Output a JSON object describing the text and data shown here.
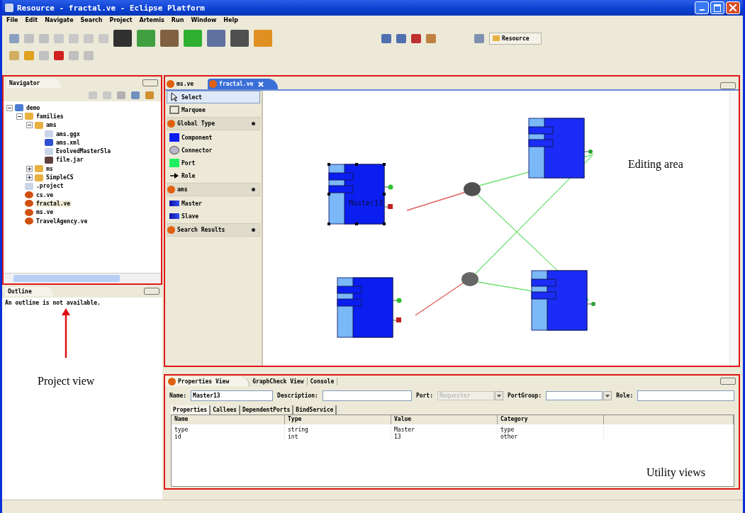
{
  "window": {
    "title": "Resource - fractal.ve - Eclipse Platform"
  },
  "menu": [
    "File",
    "Edit",
    "Navigate",
    "Search",
    "Project",
    "Artemis",
    "Run",
    "Window",
    "Help"
  ],
  "perspective": {
    "label": "Resource"
  },
  "navigator": {
    "title": "Navigator",
    "tree": [
      {
        "label": "demo",
        "kind": "project",
        "expanded": true,
        "selected": false,
        "children": [
          {
            "label": "families",
            "kind": "folder",
            "expanded": true,
            "selected": false,
            "children": [
              {
                "label": "ams",
                "kind": "folder",
                "expanded": true,
                "selected": false,
                "children": [
                  {
                    "label": "ams.ggx",
                    "kind": "file",
                    "selected": false
                  },
                  {
                    "label": "ams.xml",
                    "kind": "xml",
                    "selected": false
                  },
                  {
                    "label": "EvolvedMasterSla",
                    "kind": "file",
                    "selected": false
                  },
                  {
                    "label": "file.jar",
                    "kind": "jar",
                    "selected": false
                  }
                ]
              },
              {
                "label": "ms",
                "kind": "folder",
                "expanded": false,
                "selected": false
              },
              {
                "label": "SimpleCS",
                "kind": "folder",
                "expanded": false,
                "selected": false
              }
            ]
          },
          {
            "label": ".project",
            "kind": "file",
            "selected": false
          },
          {
            "label": "cs.ve",
            "kind": "ve",
            "selected": false
          },
          {
            "label": "fractal.ve",
            "kind": "ve",
            "selected": true
          },
          {
            "label": "ms.ve",
            "kind": "ve",
            "selected": false
          },
          {
            "label": "TravelAgency.ve",
            "kind": "ve",
            "selected": false
          }
        ]
      }
    ]
  },
  "outline": {
    "title": "Outline",
    "message": "An outline is not available."
  },
  "editor_tabs": [
    {
      "label": "ms.ve",
      "selected": false
    },
    {
      "label": "fractal.ve",
      "selected": true
    }
  ],
  "palette": [
    {
      "kind": "select",
      "label": "Select",
      "selected": true
    },
    {
      "kind": "marquee",
      "label": "Marquee",
      "selected": false
    },
    {
      "kind": "drawer",
      "label": "Global Type"
    },
    {
      "kind": "component",
      "label": "Component",
      "selected": false
    },
    {
      "kind": "connector",
      "label": "Connector",
      "selected": false
    },
    {
      "kind": "port",
      "label": "Port",
      "selected": false
    },
    {
      "kind": "role",
      "label": "Role",
      "selected": false
    },
    {
      "kind": "drawer",
      "label": "ams"
    },
    {
      "kind": "master",
      "label": "Master",
      "selected": false
    },
    {
      "kind": "slave",
      "label": "Slave",
      "selected": false
    },
    {
      "kind": "drawer",
      "label": "Search Results"
    }
  ],
  "diagram": {
    "components": [
      {
        "kind": "master",
        "label": "Master13",
        "selected": true
      },
      {
        "kind": "slave",
        "selected": false
      },
      {
        "kind": "master",
        "selected": false
      },
      {
        "kind": "slave",
        "selected": false
      }
    ]
  },
  "properties": {
    "views": [
      {
        "label": "Properties View",
        "selected": true
      },
      {
        "label": "GraphCheck View",
        "selected": false
      },
      {
        "label": "Console",
        "selected": false
      }
    ],
    "fields": [
      {
        "label": "Name:",
        "value": "Master13",
        "kind": "text"
      },
      {
        "label": "Description:",
        "kind": "text"
      },
      {
        "label": "Port:",
        "placeholder": "Requester",
        "kind": "combo",
        "disabled": true
      },
      {
        "label": "PortGroup:",
        "kind": "combo",
        "disabled": false
      },
      {
        "label": "Role:",
        "kind": "text"
      }
    ],
    "tabs": [
      {
        "label": "Properties",
        "selected": true
      },
      {
        "label": "Callees",
        "selected": false
      },
      {
        "label": "DependentPorts",
        "selected": false
      },
      {
        "label": "BindService",
        "selected": false
      }
    ],
    "columns": [
      "Name",
      "Type",
      "Value",
      "Category"
    ],
    "rows": [
      [
        "type",
        "string",
        "Master",
        "type"
      ],
      [
        "id",
        "int",
        "13",
        "other"
      ]
    ]
  },
  "annotations": [
    {
      "text": "Editing area"
    },
    {
      "text": "Project view"
    },
    {
      "text": "Utility views"
    }
  ]
}
